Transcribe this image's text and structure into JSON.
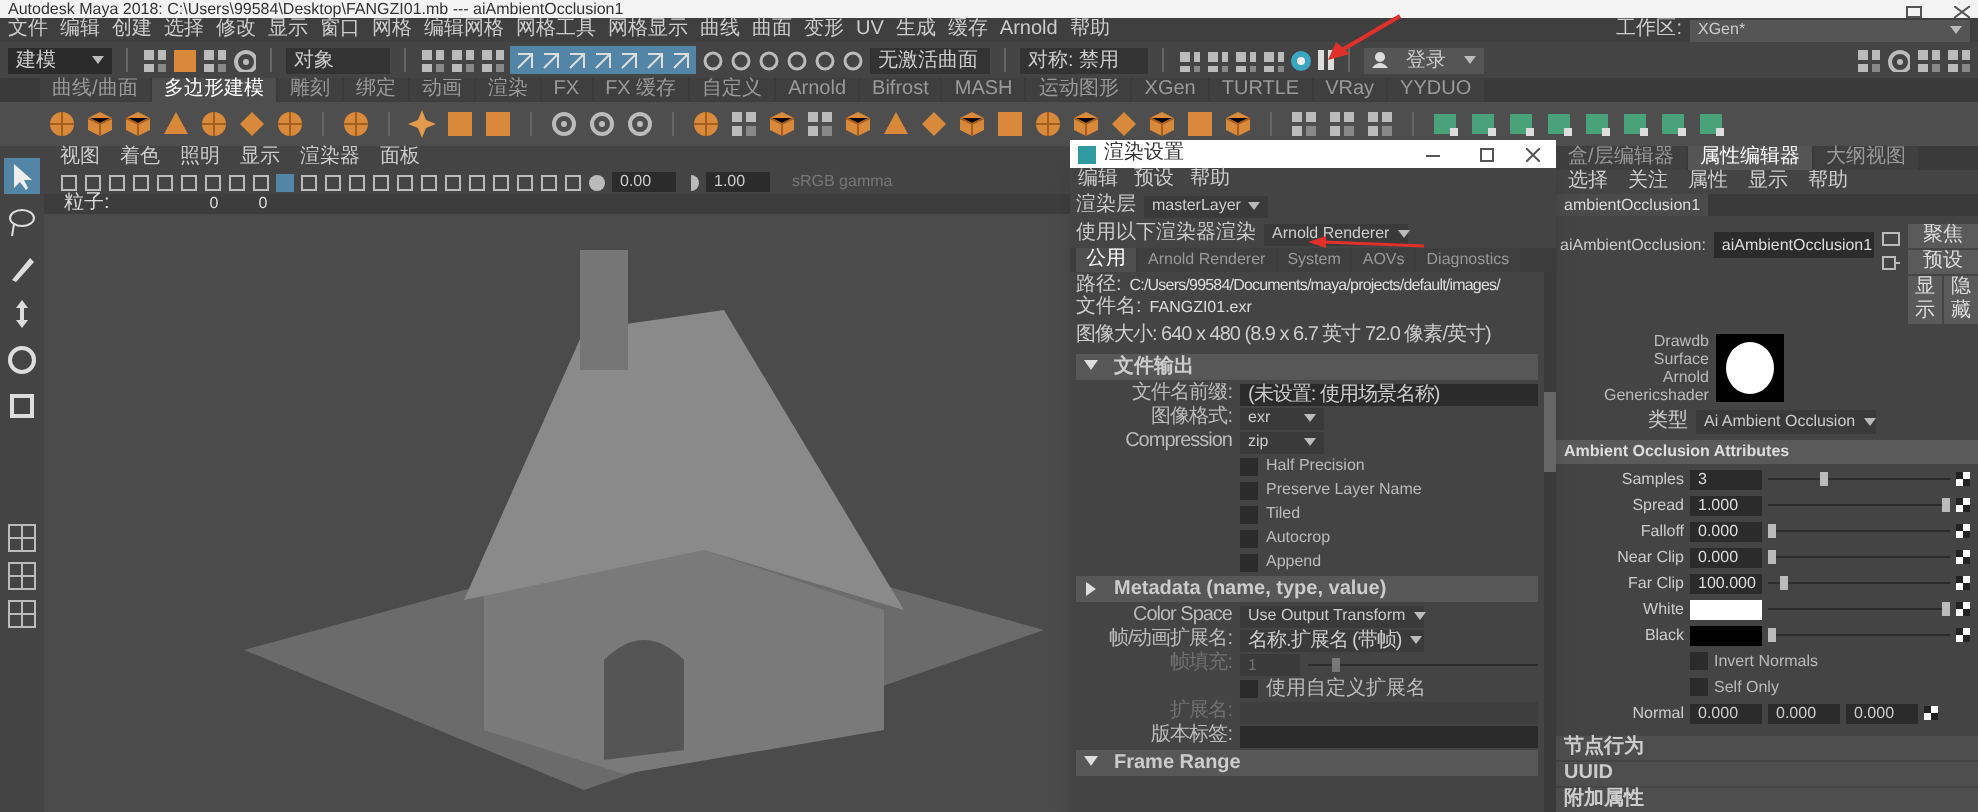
{
  "window": {
    "title": "Autodesk Maya 2018: C:\\Users\\99584\\Desktop\\FANGZI01.mb  ---  aiAmbientOcclusion1"
  },
  "menu_bar": {
    "items": [
      "文件",
      "编辑",
      "创建",
      "选择",
      "修改",
      "显示",
      "窗口",
      "网格",
      "编辑网格",
      "网格工具",
      "网格显示",
      "曲线",
      "曲面",
      "变形",
      "UV",
      "生成",
      "缓存",
      "Arnold",
      "帮助"
    ],
    "workspace_label": "工作区:",
    "workspace": "XGen*"
  },
  "status_line": {
    "mode": "建模",
    "object_field": "对象",
    "live_surface": "无激活曲面",
    "symmetry": "对称: 禁用",
    "login": "登录"
  },
  "shelf": {
    "tabs": [
      {
        "label": "曲线/曲面",
        "selected": false
      },
      {
        "label": "多边形建模",
        "selected": true
      },
      {
        "label": "雕刻",
        "selected": false
      },
      {
        "label": "绑定",
        "selected": false
      },
      {
        "label": "动画",
        "selected": false
      },
      {
        "label": "渲染",
        "selected": false
      },
      {
        "label": "FX",
        "selected": false
      },
      {
        "label": "FX 缓存",
        "selected": false
      },
      {
        "label": "自定义",
        "selected": false
      },
      {
        "label": "Arnold",
        "selected": false
      },
      {
        "label": "Bifrost",
        "selected": false
      },
      {
        "label": "MASH",
        "selected": false
      },
      {
        "label": "运动图形",
        "selected": false
      },
      {
        "label": "XGen",
        "selected": false
      },
      {
        "label": "TURTLE",
        "selected": false
      },
      {
        "label": "VRay",
        "selected": false
      },
      {
        "label": "YYDUO",
        "selected": false
      }
    ]
  },
  "toolbox": {
    "tools": [
      {
        "kind": "select",
        "selected": true
      },
      {
        "kind": "lasso",
        "selected": false
      },
      {
        "kind": "paint",
        "selected": false
      },
      {
        "kind": "move",
        "selected": false
      },
      {
        "kind": "rotate",
        "selected": false
      },
      {
        "kind": "scale",
        "selected": false
      }
    ]
  },
  "viewport": {
    "menu": [
      "视图",
      "着色",
      "照明",
      "显示",
      "渲染器",
      "面板"
    ],
    "exposure": "0.00",
    "gamma": "1.00",
    "color_space": "sRGB gamma",
    "hud": {
      "label": "粒子:",
      "values": [
        "0",
        "0"
      ]
    }
  },
  "render_settings": {
    "title": "渲染设置",
    "menu": [
      "编辑",
      "预设",
      "帮助"
    ],
    "render_layer_label": "渲染层",
    "render_layer": "masterLayer",
    "renderer_label": "使用以下渲染器渲染",
    "renderer": "Arnold Renderer",
    "tabs": [
      {
        "label": "公用",
        "selected": true
      },
      {
        "label": "Arnold Renderer",
        "selected": false
      },
      {
        "label": "System",
        "selected": false
      },
      {
        "label": "AOVs",
        "selected": false
      },
      {
        "label": "Diagnostics",
        "selected": false
      }
    ],
    "path_label": "路径:",
    "path": "C:/Users/99584/Documents/maya/projects/default/images/",
    "filename_label": "文件名:",
    "filename": "FANGZI01.exr",
    "image_size": "图像大小: 640 x 480 (8.9 x 6.7 英寸 72.0 像素/英寸)",
    "rows": [
      {
        "kind": "section",
        "label": "文件输出",
        "expanded": true
      },
      {
        "kind": "field",
        "label": "文件名前缀:",
        "value": "(未设置: 使用场景名称)",
        "disabled": false
      },
      {
        "kind": "dropdown",
        "label": "图像格式:",
        "value": "exr"
      },
      {
        "kind": "dropdown",
        "label": "Compression",
        "value": "zip"
      },
      {
        "kind": "checkbox",
        "label": "Half Precision",
        "checked": false
      },
      {
        "kind": "checkbox",
        "label": "Preserve Layer Name",
        "checked": false
      },
      {
        "kind": "checkbox",
        "label": "Tiled",
        "checked": false
      },
      {
        "kind": "checkbox",
        "label": "Autocrop",
        "checked": false
      },
      {
        "kind": "checkbox",
        "label": "Append",
        "checked": false
      },
      {
        "kind": "section",
        "label": "Metadata (name, type, value)",
        "expanded": false
      },
      {
        "kind": "dropdown",
        "label": "Color Space",
        "value": "Use Output Transform"
      },
      {
        "kind": "dropdown",
        "label": "帧/动画扩展名:",
        "value": "名称.扩展名 (带帧)"
      },
      {
        "kind": "slider",
        "label": "帧填充:",
        "value": "1",
        "level": 0.1,
        "disabled": true
      },
      {
        "kind": "checkbox",
        "label": "使用自定义扩展名",
        "checked": false
      },
      {
        "kind": "field",
        "label": "扩展名:",
        "disabled": true
      },
      {
        "kind": "field",
        "label": "版本标签:",
        "disabled": false
      },
      {
        "kind": "section",
        "label": "Frame Range",
        "expanded": true
      }
    ]
  },
  "attribute_editor": {
    "tabs": [
      {
        "label": "盒/层编辑器",
        "selected": false
      },
      {
        "label": "属性编辑器",
        "selected": true
      },
      {
        "label": "大纲视图",
        "selected": false
      }
    ],
    "menu": [
      "选择",
      "关注",
      "属性",
      "显示",
      "帮助"
    ],
    "node_tab": "ambientOcclusion1",
    "node_label": "aiAmbientOcclusion:",
    "node_name": "aiAmbientOcclusion1",
    "buttons": [
      "聚焦",
      "预设",
      "显示",
      "隐藏"
    ],
    "swatch_labels": [
      "Drawdb",
      "Surface",
      "Arnold",
      "Genericshader"
    ],
    "type_label": "类型",
    "type": "Ai Ambient Occlusion",
    "section": "Ambient Occlusion Attributes",
    "attributes": [
      {
        "kind": "slider",
        "label": "Samples",
        "value": "3",
        "level": 0.3
      },
      {
        "kind": "slider",
        "label": "Spread",
        "value": "1.000",
        "level": 1
      },
      {
        "kind": "slider",
        "label": "Falloff",
        "value": "0.000",
        "level": 0
      },
      {
        "kind": "slider",
        "label": "Near Clip",
        "value": "0.000",
        "level": 0
      },
      {
        "kind": "slider",
        "label": "Far Clip",
        "value": "100.000",
        "level": 0.07
      },
      {
        "kind": "color",
        "label": "White",
        "color": "#ffffff",
        "level": 1
      },
      {
        "kind": "color",
        "label": "Black",
        "color": "#000000",
        "level": 0
      },
      {
        "kind": "checkbox",
        "label": "Invert Normals",
        "checked": false
      },
      {
        "kind": "checkbox",
        "label": "Self Only",
        "checked": false
      },
      {
        "kind": "vector",
        "label": "Normal",
        "values": [
          "0.000",
          "0.000",
          "0.000"
        ]
      }
    ],
    "collapsed_sections": [
      "节点行为",
      "UUID",
      "附加属性"
    ]
  }
}
